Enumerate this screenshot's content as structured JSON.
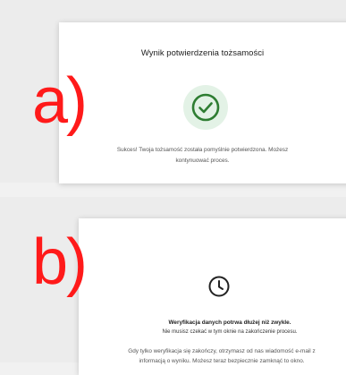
{
  "panel_a": {
    "label": "a)",
    "title": "Wynik potwierdzenia tożsamości",
    "icon": "check-circle-icon",
    "accent": "#2e7d32",
    "icon_bg": "#e3f2e6",
    "message_line1": "Sukces! Twoja tożsamość została pomyślnie potwierdzona. Możesz",
    "message_line2": "kontynuować proces."
  },
  "panel_b": {
    "label": "b)",
    "icon": "clock-icon",
    "heading": "Weryfikacja danych potrwa dłużej niż zwykle.",
    "subheading": "Nie musisz czekać w tym oknie na zakończenie procesu.",
    "message_line1": "Gdy tylko weryfikacja się zakończy, otrzymasz od nas wiadomość e-mail z",
    "message_line2": "informacją o wyniku. Możesz teraz bezpiecznie zamknąć to okno."
  },
  "label_color": "#ff1a1a"
}
